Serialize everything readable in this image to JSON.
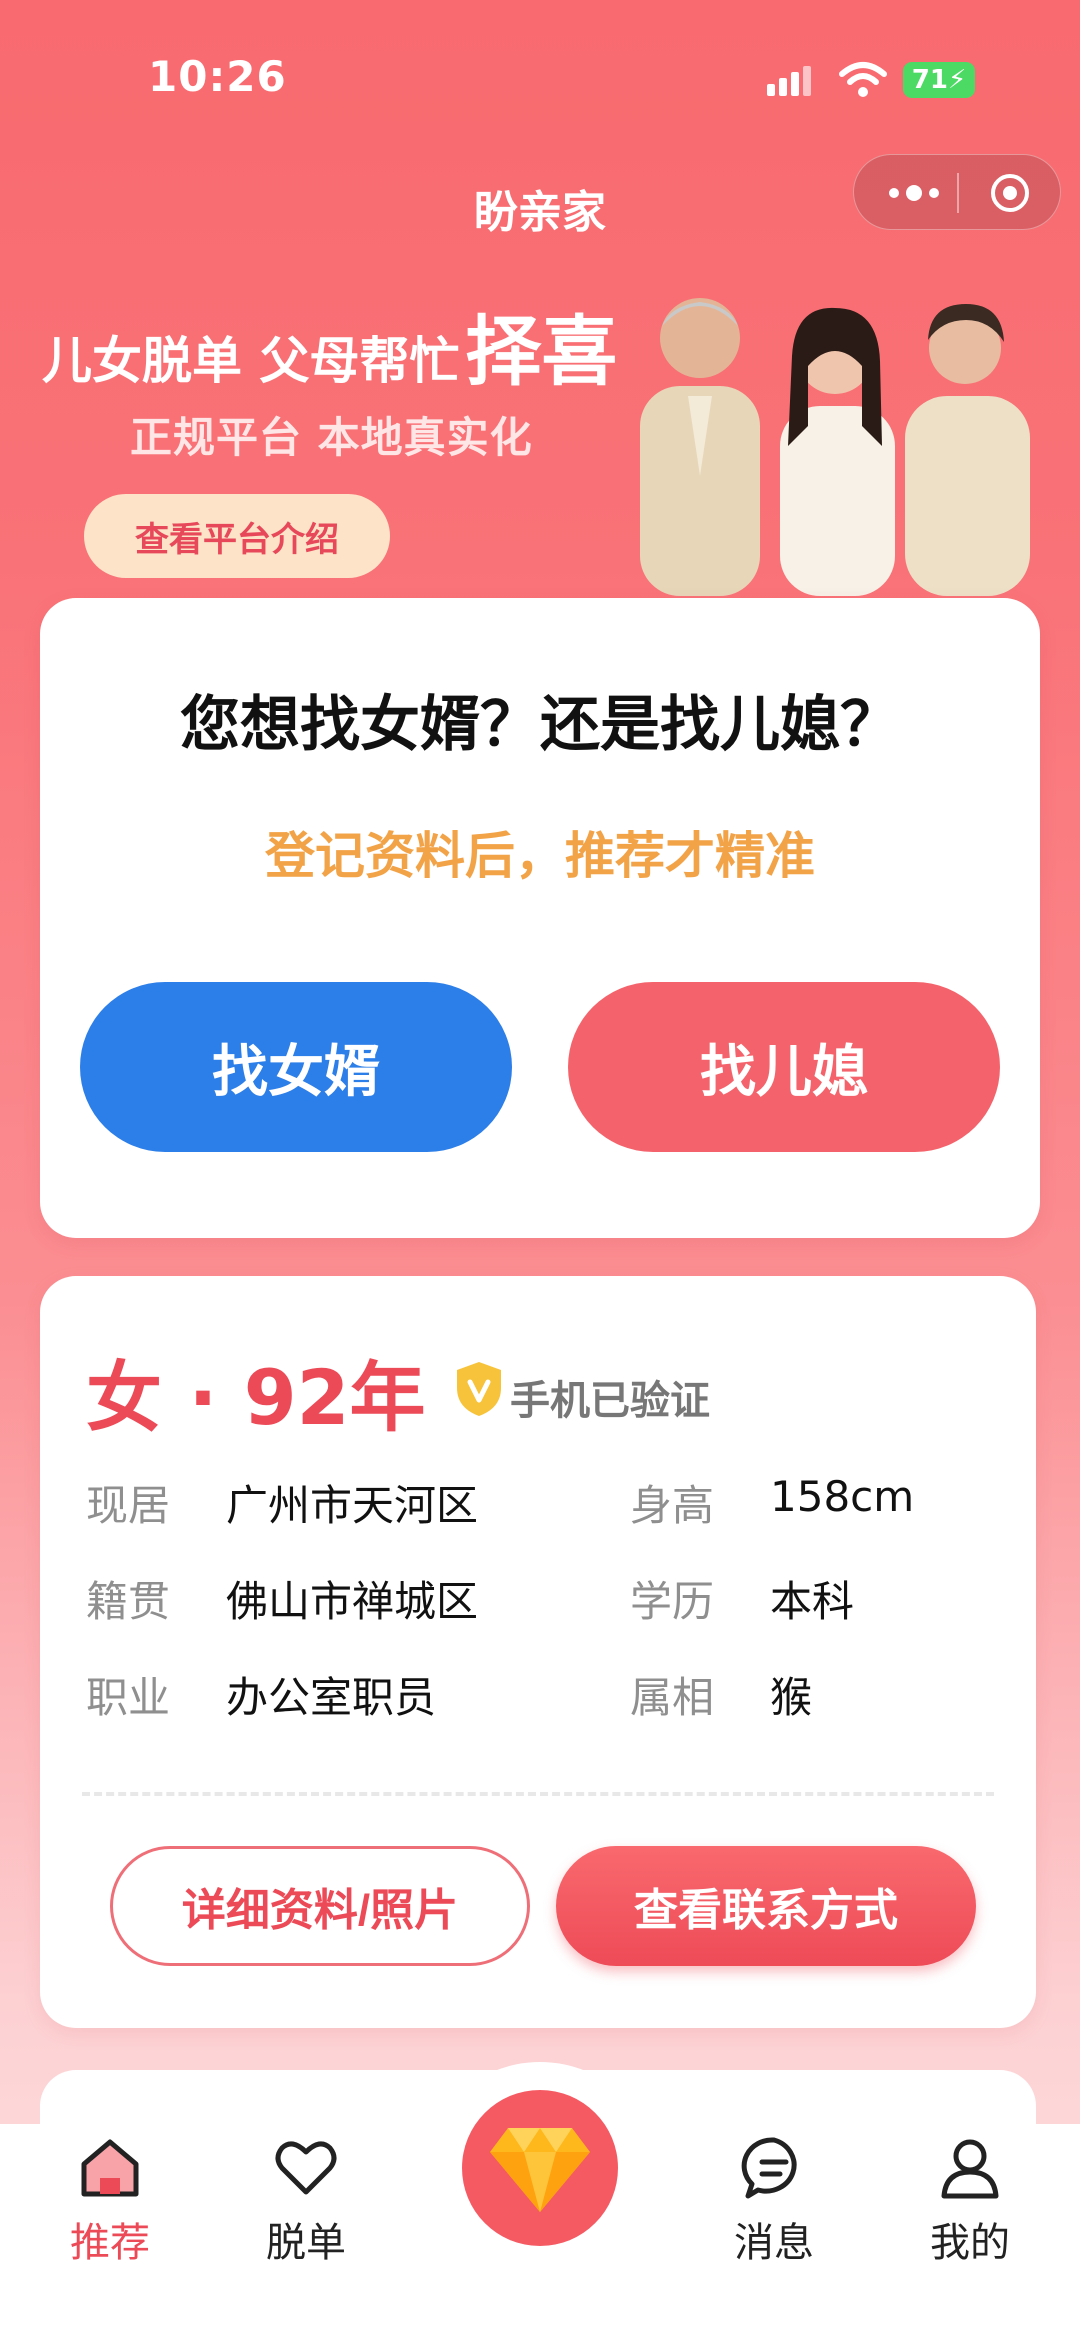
{
  "status_bar": {
    "time": "10:26",
    "battery": "71"
  },
  "app": {
    "title": "盼亲家"
  },
  "hero": {
    "headline_small": "儿女脱单 父母帮忙",
    "headline_big": "择喜",
    "subtitle": "正规平台 本地真实化",
    "button": "查看平台介绍"
  },
  "question_card": {
    "title": "您想找女婿？还是找儿媳？",
    "subtitle": "登记资料后，推荐才精准",
    "btn_son_in_law": "找女婿",
    "btn_daughter_in_law": "找儿媳"
  },
  "profile": {
    "gender_year": "女 · 92年",
    "verified_label": "手机已验证",
    "fields": [
      {
        "label": "现居",
        "value": "广州市天河区"
      },
      {
        "label": "身高",
        "value": "158cm"
      },
      {
        "label": "籍贯",
        "value": "佛山市禅城区"
      },
      {
        "label": "学历",
        "value": "本科"
      },
      {
        "label": "职业",
        "value": "办公室职员"
      },
      {
        "label": "属相",
        "value": "猴"
      }
    ],
    "btn_detail": "详细资料/照片",
    "btn_contact": "查看联系方式"
  },
  "tabbar": {
    "items": [
      {
        "label": "推荐",
        "icon": "home-icon",
        "active": true
      },
      {
        "label": "脱单",
        "icon": "heart-icon"
      },
      {
        "label": "",
        "icon": "diamond-icon"
      },
      {
        "label": "消息",
        "icon": "chat-icon"
      },
      {
        "label": "我的",
        "icon": "user-icon"
      }
    ]
  },
  "colors": {
    "primary_red": "#ec4a57",
    "blue": "#2c7ee8",
    "orange_text": "#f2a348"
  }
}
